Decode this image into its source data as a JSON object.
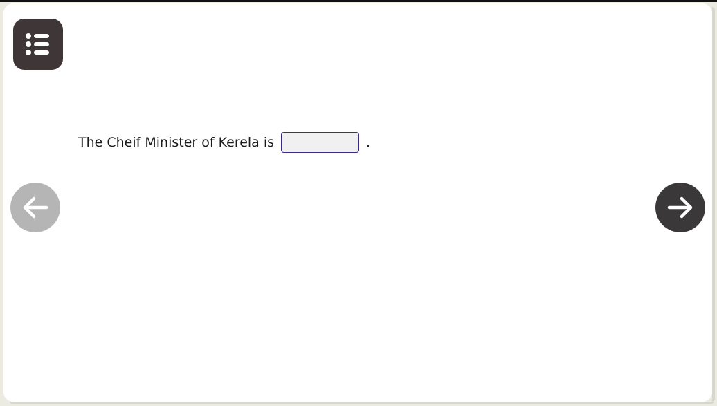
{
  "question": {
    "prefix": "The Cheif Minister of Kerela is",
    "answer_value": "",
    "answer_placeholder": "",
    "suffix": "."
  },
  "icons": {
    "menu": "list-icon",
    "prev": "arrow-left-icon",
    "next": "arrow-right-icon"
  },
  "colors": {
    "menu_button": "#3f3637",
    "prev_button_disabled": "#b5b5b5",
    "next_button": "#3a3838",
    "input_border": "#3b2a86",
    "input_background": "#f0f0f0"
  }
}
